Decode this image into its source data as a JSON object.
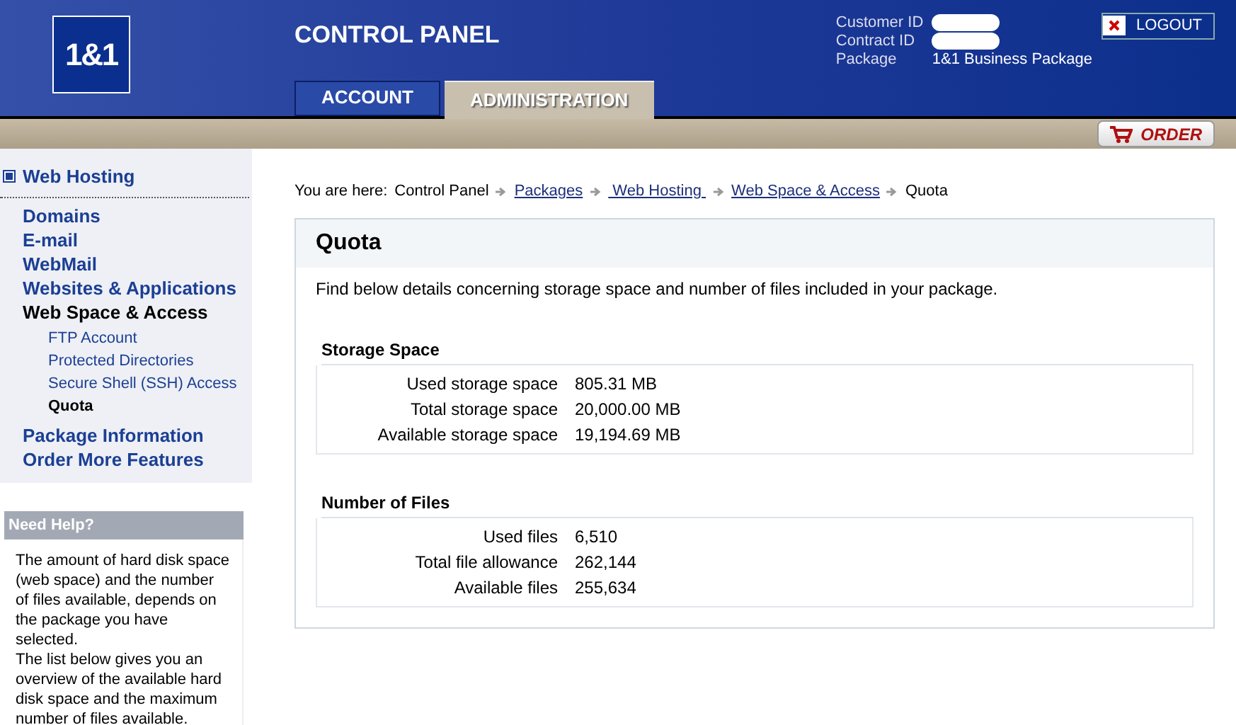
{
  "header": {
    "logo": "1&1",
    "title": "CONTROL PANEL",
    "info": [
      {
        "label": "Customer ID",
        "redacted": true
      },
      {
        "label": "Contract ID",
        "redacted": true
      },
      {
        "label": "Package",
        "value": "1&1 Business Package"
      }
    ],
    "logout": "LOGOUT",
    "order": "ORDER"
  },
  "tabs": [
    {
      "label": "ACCOUNT",
      "selected": false
    },
    {
      "label": "ADMINISTRATION",
      "selected": true
    }
  ],
  "sidebar": {
    "section": "Web Hosting",
    "items": [
      {
        "label": "Domains",
        "selected": false
      },
      {
        "label": "E-mail",
        "selected": false
      },
      {
        "label": "WebMail",
        "selected": false
      },
      {
        "label": "Websites & Applications",
        "selected": false
      },
      {
        "label": "Web Space & Access",
        "selected": true,
        "children": [
          {
            "label": "FTP Account",
            "selected": false
          },
          {
            "label": "Protected Directories",
            "selected": false
          },
          {
            "label": "Secure Shell (SSH) Access",
            "selected": false
          },
          {
            "label": "Quota",
            "selected": true
          }
        ]
      },
      {
        "label": "Package Information",
        "selected": false
      },
      {
        "label": "Order More Features",
        "selected": false
      }
    ]
  },
  "help": {
    "title": "Need Help?",
    "paragraphs": [
      "The amount of hard disk space (web space) and the number of files available, depends on the package you have selected.",
      "The list below gives you an overview of the available hard disk space and the maximum number of files available."
    ]
  },
  "breadcrumb": {
    "prefix": "You are here:",
    "items": [
      {
        "label": "Control Panel",
        "link": false
      },
      {
        "label": "Packages",
        "link": true
      },
      {
        "label": " Web Hosting ",
        "link": true
      },
      {
        "label": "Web Space & Access",
        "link": true
      },
      {
        "label": "Quota",
        "link": false
      }
    ]
  },
  "page": {
    "title": "Quota",
    "intro": "Find below details concerning storage space and number of files included in your package.",
    "sections": [
      {
        "title": "Storage Space",
        "rows": [
          {
            "label": "Used storage space",
            "value": "805.31 MB"
          },
          {
            "label": "Total storage space",
            "value": "20,000.00 MB"
          },
          {
            "label": "Available storage space",
            "value": "19,194.69 MB"
          }
        ]
      },
      {
        "title": "Number of Files",
        "rows": [
          {
            "label": "Used files",
            "value": "6,510"
          },
          {
            "label": "Total file allowance",
            "value": "262,144"
          },
          {
            "label": "Available files",
            "value": "255,634"
          }
        ]
      }
    ]
  }
}
